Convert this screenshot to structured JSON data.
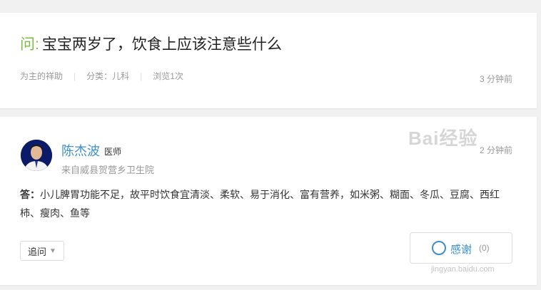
{
  "question": {
    "prefix": "问:",
    "title": "宝宝两岁了，饮食上应该注意些什么",
    "author": "为主的祥助",
    "category": "分类：儿科",
    "views": "浏览1次",
    "time": "3 分钟前"
  },
  "answer": {
    "doctor_name": "陈杰波",
    "doctor_title": "医师",
    "from": "来自威县贺营乡卫生院",
    "time": "2 分钟前",
    "label": "答：",
    "text": "小儿脾胃功能不足，故平时饮食宜清淡、柔软、易于消化、富有营养，如米粥、糊面、冬瓜、豆腐、西红柿、瘦肉、鱼等",
    "ask_button": "追问",
    "thanks_button": "感谢",
    "thanks_count": "(0)"
  },
  "watermark": {
    "logo": "Bai经验",
    "url": "jingyan.baidu.com"
  },
  "colors": {
    "accent_green": "#7cba42",
    "link_blue": "#3d8fd0",
    "muted": "#999999"
  }
}
